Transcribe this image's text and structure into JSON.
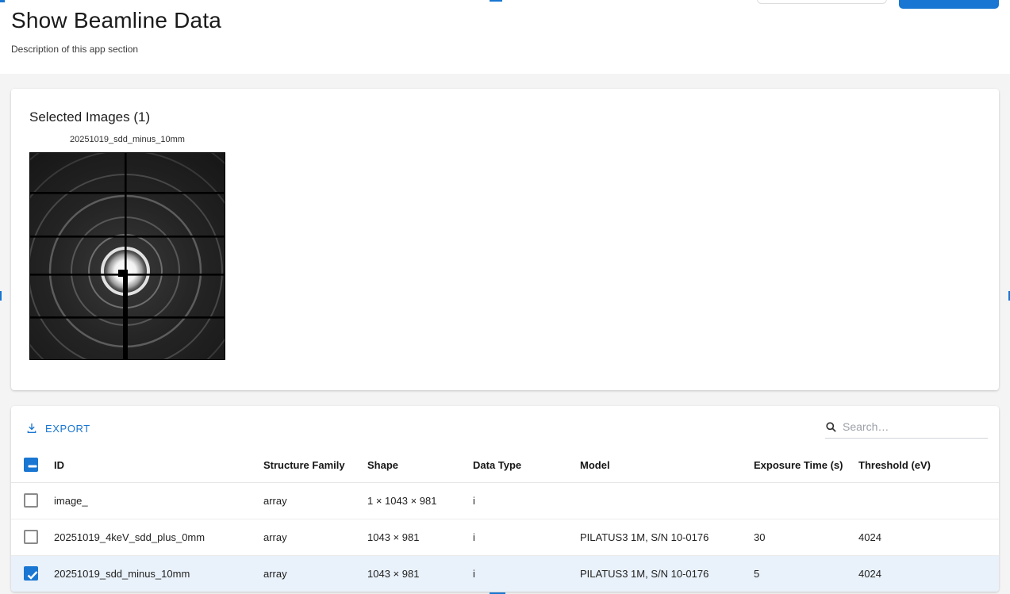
{
  "page": {
    "title": "Show Beamline Data",
    "subtitle": "Description of this app section"
  },
  "selected_images": {
    "heading": "Selected Images (1)",
    "image_caption": "20251019_sdd_minus_10mm",
    "image_description": "x-ray-diffraction-pattern"
  },
  "table": {
    "toolbar": {
      "export_label": "EXPORT",
      "search_placeholder": "Search…"
    },
    "header_checkbox_indeterminate": true,
    "columns": [
      "ID",
      "Structure Family",
      "Shape",
      "Data Type",
      "Model",
      "Exposure Time (s)",
      "Threshold (eV)"
    ],
    "rows": [
      {
        "id": "image_",
        "structure_family": "array",
        "shape": "1 × 1043 × 981",
        "data_type": "i",
        "model": "",
        "exposure_time": "",
        "threshold": "",
        "checked": false
      },
      {
        "id": "20251019_4keV_sdd_plus_0mm",
        "structure_family": "array",
        "shape": "1043 × 981",
        "data_type": "i",
        "model": "PILATUS3 1M, S/N 10-0176",
        "exposure_time": "30",
        "threshold": "4024",
        "checked": false
      },
      {
        "id": "20251019_sdd_minus_10mm",
        "structure_family": "array",
        "shape": "1043 × 981",
        "data_type": "i",
        "model": "PILATUS3 1M, S/N 10-0176",
        "exposure_time": "5",
        "threshold": "4024",
        "checked": true
      }
    ]
  },
  "colors": {
    "accent": "#1976d2",
    "selected_row": "#e9f1fa",
    "page_background": "#f4f4f5"
  },
  "icons": {
    "export": "download-icon",
    "search": "magnifier-icon"
  }
}
